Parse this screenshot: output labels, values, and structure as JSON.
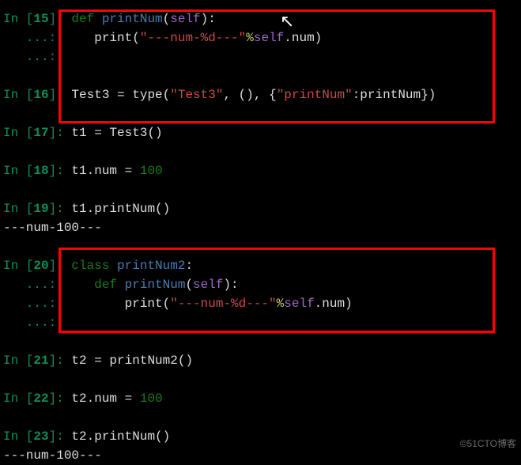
{
  "prompt": {
    "in": "In [",
    "close": "]: ",
    "dots": "   ...: "
  },
  "lines": {
    "l15": {
      "num": "15",
      "t1": "def ",
      "t2": "printNum",
      "t3": "(",
      "t4": "self",
      "t5": "):"
    },
    "l15b": {
      "t1": "    print(",
      "t2": "\"---num-%d---\"",
      "t3": "%",
      "t4": "self",
      "t5": ".num)"
    },
    "l16": {
      "num": "16",
      "t1": "Test3 = type(",
      "t2": "\"Test3\"",
      "t3": ", (), {",
      "t4": "\"printNum\"",
      "t5": ":printNum})"
    },
    "l17": {
      "num": "17",
      "t1": "t1 = Test3()"
    },
    "l18": {
      "num": "18",
      "t1": "t1.num = ",
      "t2": "100"
    },
    "l19": {
      "num": "19",
      "t1": "t1.printNum()"
    },
    "out19": "---num-100---",
    "l20": {
      "num": "20",
      "t1": "class ",
      "t2": "printNum2",
      "t3": ":"
    },
    "l20b": {
      "t1": "    ",
      "t2": "def ",
      "t3": "printNum",
      "t4": "(",
      "t5": "self",
      "t6": "):"
    },
    "l20c": {
      "t1": "        print(",
      "t2": "\"---num-%d---\"",
      "t3": "%",
      "t4": "self",
      "t5": ".num)"
    },
    "l21": {
      "num": "21",
      "t1": "t2 = printNum2()"
    },
    "l22": {
      "num": "22",
      "t1": "t2.num = ",
      "t2": "100"
    },
    "l23": {
      "num": "23",
      "t1": "t2.printNum()"
    },
    "out23": "---num-100---"
  },
  "watermark": "©51CTO博客",
  "chart_data": null
}
